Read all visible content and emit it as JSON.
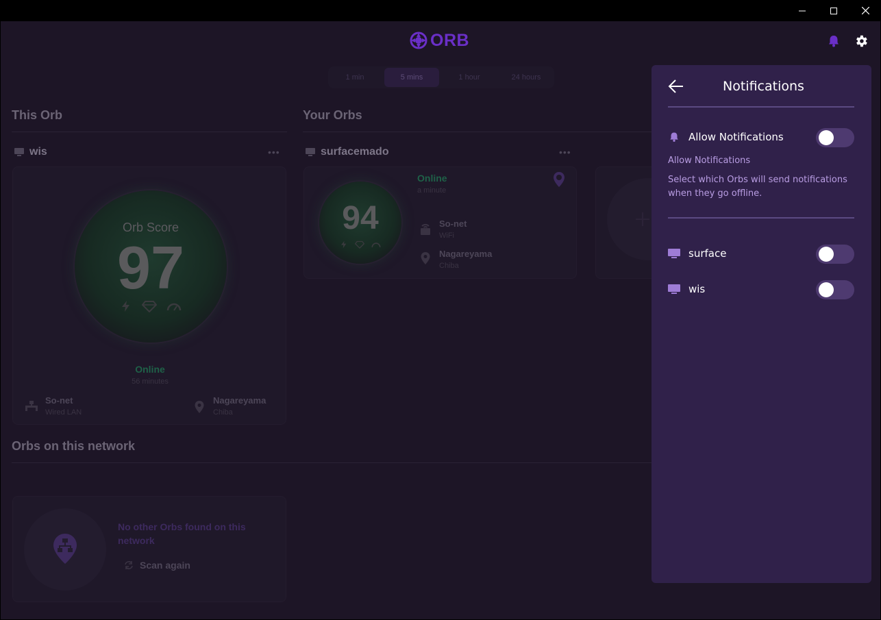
{
  "window": {
    "controls": [
      "minimize",
      "maximize",
      "close"
    ]
  },
  "header": {
    "logo_text": "ORB",
    "brand_color": "#6a2fc7",
    "icons": [
      "bell-icon",
      "gear-icon"
    ]
  },
  "time_range": {
    "options": [
      "1 min",
      "5 mins",
      "1 hour",
      "24 hours"
    ],
    "selected": "5 mins"
  },
  "this_orb": {
    "section_title": "This Orb",
    "device_name": "wis",
    "more_label": "•••",
    "score_label": "Orb Score",
    "score": "97",
    "status": "Online",
    "status_time": "56 minutes",
    "network_name": "So-net",
    "network_type": "Wired LAN",
    "location_city": "Nagareyama",
    "location_region": "Chiba"
  },
  "your_orbs": {
    "section_title": "Your Orbs",
    "device_name": "surfacemado",
    "more_label": "•••",
    "score": "94",
    "status": "Online",
    "status_time": "a minute",
    "network_name": "So-net",
    "network_type": "WiFi",
    "location_city": "Nagareyama",
    "location_region": "Chiba"
  },
  "network_orbs": {
    "section_title": "Orbs on this network",
    "empty_message": "No other Orbs found on this network",
    "scan_label": "Scan again"
  },
  "notifications": {
    "title": "Notifications",
    "allow_label": "Allow Notifications",
    "allow_enabled": false,
    "subheading": "Allow Notifications",
    "description": "Select which Orbs will send notifications when they go offline.",
    "devices": [
      {
        "name": "surface",
        "enabled": false
      },
      {
        "name": "wis",
        "enabled": false
      }
    ],
    "accent_color": "#b99de3"
  }
}
